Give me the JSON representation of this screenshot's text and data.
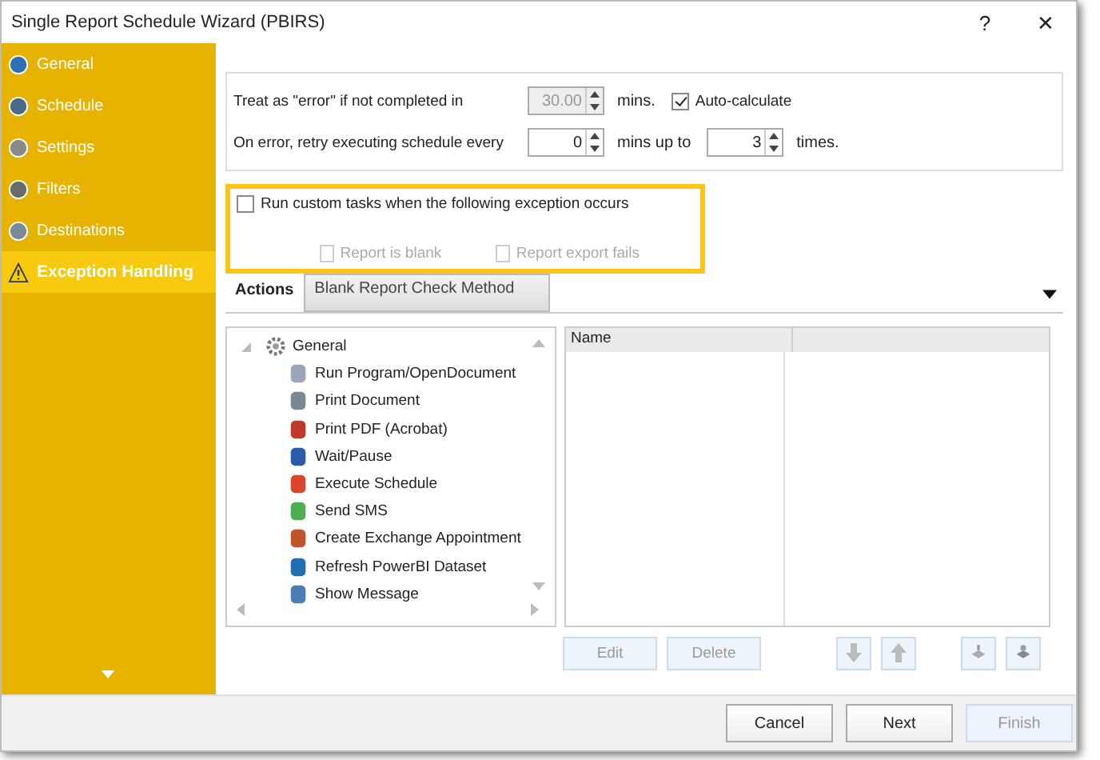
{
  "window": {
    "title": "Single Report Schedule Wizard (PBIRS)",
    "help": "?",
    "close": "✕"
  },
  "sidebar": {
    "items": [
      {
        "label": "General",
        "selected": false
      },
      {
        "label": "Schedule",
        "selected": false
      },
      {
        "label": "Settings",
        "selected": false
      },
      {
        "label": "Filters",
        "selected": false
      },
      {
        "label": "Destinations",
        "selected": false
      },
      {
        "label": "Exception Handling",
        "selected": true
      }
    ]
  },
  "timeout": {
    "label": "Treat as \"error\" if not completed in",
    "value": "30.00",
    "disabled": true,
    "unit": "mins.",
    "auto_calculate": {
      "label": "Auto-calculate",
      "checked": true
    }
  },
  "retry": {
    "label": "On error, retry  executing schedule every",
    "value": "0",
    "unit": "mins up to",
    "times_value": "3",
    "times_unit": "times."
  },
  "exceptions": {
    "run_custom": {
      "label": "Run custom tasks when the following exception occurs",
      "checked": false
    },
    "options": [
      {
        "label": "Report is blank",
        "checked": false,
        "disabled": true
      },
      {
        "label": "Report export fails",
        "checked": false,
        "disabled": true
      }
    ]
  },
  "tabs": [
    {
      "label": "Actions",
      "selected": true
    },
    {
      "label": "Blank Report Check Method",
      "selected": false
    }
  ],
  "tree": {
    "label": "General",
    "expanded": true,
    "children": [
      {
        "label": "Run Program/OpenDocument"
      },
      {
        "label": "Print Document"
      },
      {
        "label": "Print PDF (Acrobat)"
      },
      {
        "label": "Wait/Pause"
      },
      {
        "label": "Execute Schedule"
      },
      {
        "label": "Send SMS"
      },
      {
        "label": "Create Exchange Appointment"
      },
      {
        "label": "Refresh PowerBI Dataset"
      },
      {
        "label": "Show Message"
      }
    ]
  },
  "table": {
    "columns": [
      "Name"
    ]
  },
  "list_buttons": [
    {
      "label": "Edit",
      "disabled": true
    },
    {
      "label": "Delete",
      "disabled": true
    }
  ],
  "footer_buttons": [
    {
      "label": "Cancel",
      "disabled": false
    },
    {
      "label": "Next",
      "disabled": false
    },
    {
      "label": "Finish",
      "disabled": true
    }
  ]
}
